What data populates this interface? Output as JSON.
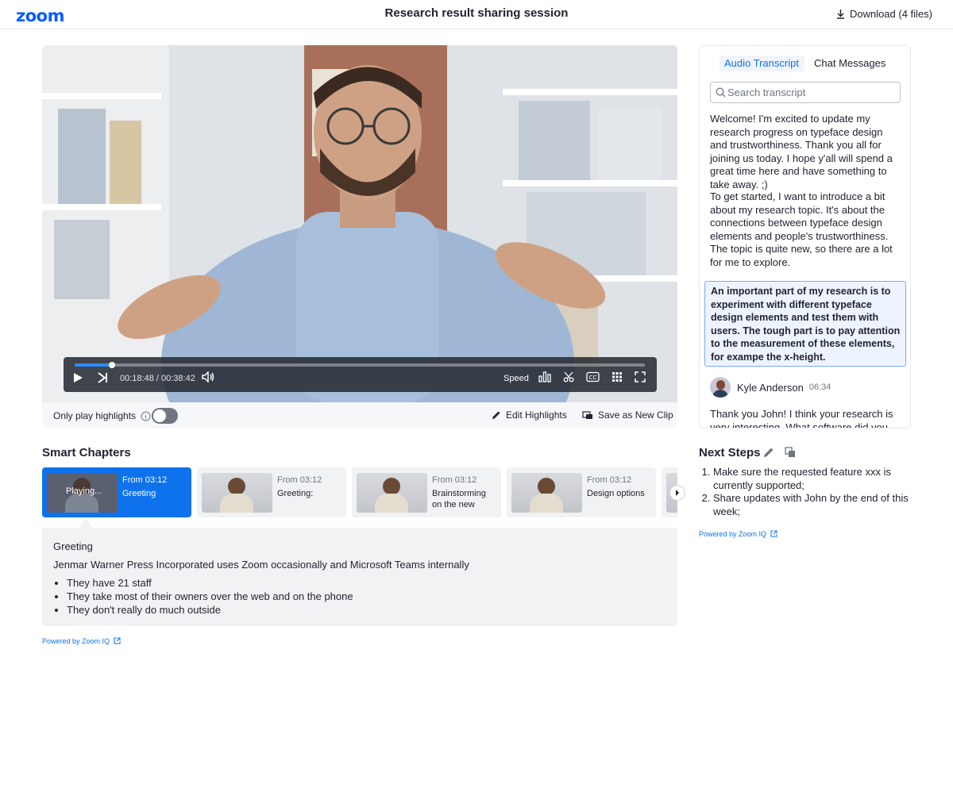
{
  "header": {
    "logo": "zoom",
    "title": "Research result sharing session",
    "download_label": "Download (4 files)"
  },
  "player": {
    "progress": 0.0658,
    "buffered": 0.32,
    "time_readout": "00:18:48 / 00:38:42",
    "speed_label": "Speed",
    "icons": [
      "play-icon",
      "skip-next-icon",
      "volume-icon",
      "speed-label",
      "bar-chart-icon",
      "scissors-icon",
      "closed-caption-icon",
      "grid-icon",
      "fullscreen-icon"
    ]
  },
  "video_footer": {
    "only_highlights_label": "Only play highlights",
    "toggle_on": false,
    "edit_highlights_label": "Edit Highlights",
    "save_clip_label": "Save as New Clip"
  },
  "chapters": {
    "heading": "Smart Chapters",
    "items": [
      {
        "from": "From 03:12",
        "title": "Greeting",
        "playing_label": "Playing...",
        "active": true
      },
      {
        "from": "From 03:12",
        "title": "Greeting:"
      },
      {
        "from": "From 03:12",
        "title": "Brainstorming on the new ide..."
      },
      {
        "from": "From 03:12",
        "title": "Design options"
      },
      {
        "from": "",
        "title": ""
      }
    ],
    "detail": {
      "title": "Greeting",
      "description": "Jenmar Warner Press Incorporated uses Zoom occasionally and Microsoft Teams internally",
      "bullets": [
        "They have 21 staff",
        "They take most of their owners over the web and on the phone",
        "They don't really do much outside"
      ]
    },
    "powered_by": "Powered by Zoom IQ"
  },
  "transcript": {
    "tabs": [
      "Audio Transcript",
      "Chat Messages"
    ],
    "search_placeholder": "Search transcript",
    "paragraphs": [
      "Welcome! I'm excited to update my research progress on typeface design and trustworthiness. Thank you all for joining us today. I hope y'all will spend a great time here and have something to take away. ;)",
      "To get started, I want to introduce a bit about my research topic. It's about the connections between typeface design elements and people's trustworthiness. The topic is quite new, so there are a lot for me to explore."
    ],
    "highlighted": "An important part of my research is to experiment with different typeface design elements and test them with users. The tough part is to pay attention to the measurement of these elements, for exampe the x-height.",
    "speaker": {
      "name": "Kyle Anderson",
      "time": "06:34"
    },
    "reply": "Thank you John! I think your research is very interesting. What software did you use"
  },
  "next_steps": {
    "title": "Next Steps",
    "items": [
      "Make sure the requested feature xxx is currently supported;",
      "Share updates with John by the end of this week;"
    ],
    "powered_by": "Powered by Zoom IQ"
  },
  "colors": {
    "brand": "#0b5cff",
    "accent": "#0e72ed",
    "text": "#232333"
  }
}
